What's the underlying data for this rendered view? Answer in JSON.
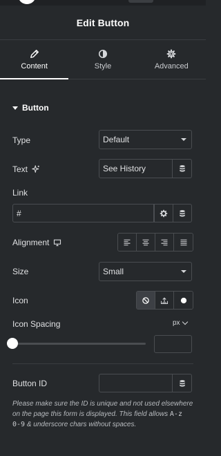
{
  "header": {
    "title": "Edit Button"
  },
  "tabs": [
    {
      "label": "Content",
      "icon": "pencil-icon",
      "active": true
    },
    {
      "label": "Style",
      "icon": "half-circle-icon",
      "active": false
    },
    {
      "label": "Advanced",
      "icon": "gear-icon",
      "active": false
    }
  ],
  "section": {
    "title": "Button"
  },
  "fields": {
    "type": {
      "label": "Type",
      "value": "Default"
    },
    "text": {
      "label": "Text",
      "value": "See History"
    },
    "link": {
      "label": "Link",
      "value": "#"
    },
    "alignment": {
      "label": "Alignment",
      "options": [
        "left",
        "center",
        "right",
        "justify"
      ]
    },
    "size": {
      "label": "Size",
      "value": "Small"
    },
    "icon": {
      "label": "Icon",
      "options": [
        "none",
        "upload",
        "circle"
      ],
      "selected": "none"
    },
    "icon_spacing": {
      "label": "Icon Spacing",
      "unit": "px",
      "value": ""
    },
    "button_id": {
      "label": "Button ID",
      "value": ""
    }
  },
  "note": {
    "part1": "Please make sure the ID is unique and not used elsewhere on the page this form is displayed. This field allows",
    "code": "A-z 0-9",
    "part2": "& underscore chars without spaces."
  },
  "colors": {
    "background": "#26292c",
    "border": "#4a4d51",
    "text": "#e0e1e3",
    "active_tab": "#ffffff"
  }
}
